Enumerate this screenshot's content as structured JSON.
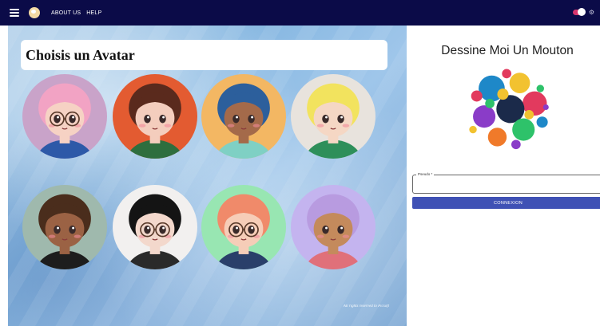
{
  "nav": {
    "about": "ABOUT US",
    "help": "HELP"
  },
  "page": {
    "heading": "Choisis un Avatar",
    "rights": "All rights reserved to Picsoft"
  },
  "login": {
    "title": "Dessine Moi Un Mouton",
    "pseudo_label": "Pseudo *",
    "pseudo_value": "",
    "button_label": "CONNEXION"
  },
  "colors": {
    "topbar": "#0b0b48",
    "accent": "#3f51b5",
    "toggle": "#d7356d"
  },
  "avatars": [
    {
      "id": "avatar-1",
      "bg": "#c9a3c9",
      "hair": "#f2a3c4",
      "skin": "#f6d2c4",
      "top": "#2d59a8",
      "glasses": true
    },
    {
      "id": "avatar-2",
      "bg": "#e35b31",
      "hair": "#5a2a1d",
      "skin": "#f4cdbd",
      "top": "#2e6e3e",
      "glasses": false
    },
    {
      "id": "avatar-3",
      "bg": "#f3b763",
      "hair": "#2c5f9c",
      "skin": "#a46a4a",
      "top": "#7fd0c4",
      "glasses": false
    },
    {
      "id": "avatar-4",
      "bg": "#e8e3dd",
      "hair": "#f2e35e",
      "skin": "#f5d7c4",
      "top": "#2e8f5a",
      "glasses": false
    },
    {
      "id": "avatar-5",
      "bg": "#9fb9ad",
      "hair": "#4a2d1c",
      "skin": "#9b6244",
      "top": "#1d1d1d",
      "glasses": false
    },
    {
      "id": "avatar-6",
      "bg": "#f2f0ef",
      "hair": "#141414",
      "skin": "#f3d8cc",
      "top": "#2a2a2a",
      "glasses": true
    },
    {
      "id": "avatar-7",
      "bg": "#98e6b2",
      "hair": "#f08a6a",
      "skin": "#f6cdb8",
      "top": "#2a3f6a",
      "glasses": true
    },
    {
      "id": "avatar-8",
      "bg": "#c4b4ef",
      "hair": "#b89be0",
      "skin": "#c48a5c",
      "top": "#e0707a",
      "glasses": false
    }
  ]
}
